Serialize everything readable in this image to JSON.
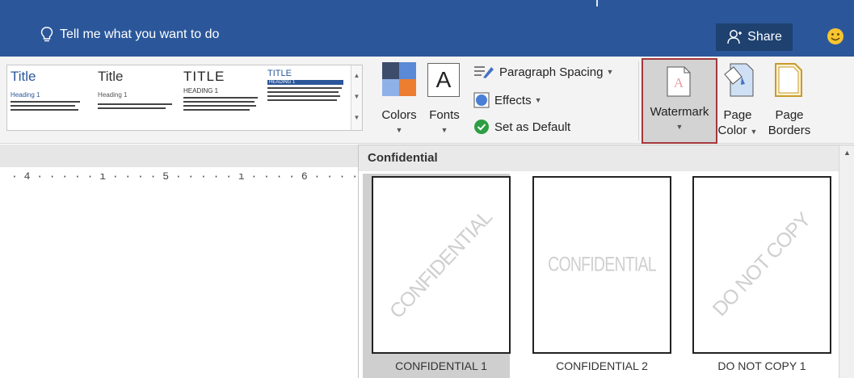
{
  "title_bar": {
    "tell_me": "Tell me what you want to do",
    "share_label": "Share"
  },
  "ribbon": {
    "style_gallery": [
      {
        "title": "Title",
        "heading": "Heading 1"
      },
      {
        "title": "Title",
        "heading": "Heading 1"
      },
      {
        "title": "TITLE",
        "heading": "HEADING 1"
      },
      {
        "title": "TITLE",
        "heading": "HEADING 1"
      }
    ],
    "colors_label": "Colors",
    "fonts_label": "Fonts",
    "fonts_glyph": "A",
    "paragraph_spacing_label": "Paragraph Spacing",
    "effects_label": "Effects",
    "set_default_label": "Set as Default",
    "watermark_label": "Watermark",
    "page_color_label_1": "Page",
    "page_color_label_2": "Color",
    "page_borders_label_1": "Page",
    "page_borders_label_2": "Borders"
  },
  "ruler": {
    "text": "· 4 · · · · · ı · · · · 5 · · · · · ı · · · · 6 · · · · · △ · · ·"
  },
  "watermark_panel": {
    "section_title": "Confidential",
    "items": [
      {
        "caption": "CONFIDENTIAL 1",
        "watermark": "CONFIDENTIAL",
        "orientation": "diagonal",
        "selected": true
      },
      {
        "caption": "CONFIDENTIAL 2",
        "watermark": "CONFIDENTIAL",
        "orientation": "horizontal",
        "selected": false
      },
      {
        "caption": "DO NOT COPY 1",
        "watermark": "DO NOT COPY",
        "orientation": "diagonal",
        "selected": false
      }
    ]
  },
  "colors": {
    "title_bar_blue": "#2b579a",
    "share_button": "#1e4170",
    "watermark_highlight_border": "#a4373a",
    "watermark_text": "#cfcfcf"
  }
}
